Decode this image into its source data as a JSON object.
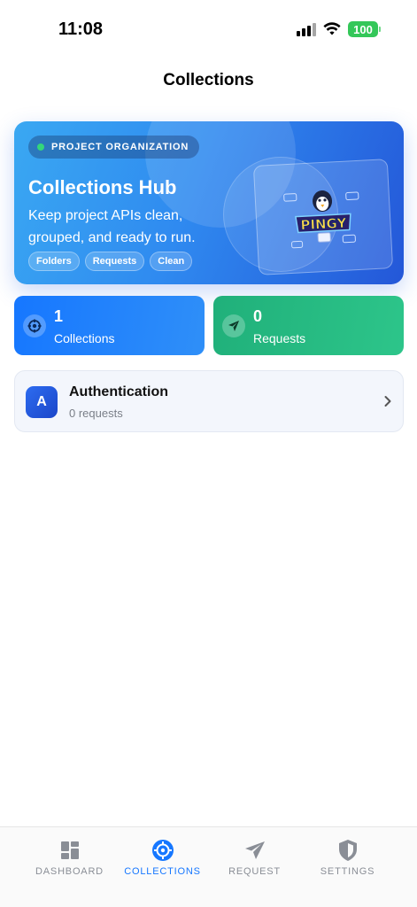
{
  "status_bar": {
    "time": "11:08",
    "battery": "100"
  },
  "header": {
    "title": "Collections"
  },
  "hero": {
    "badge": "PROJECT ORGANIZATION",
    "title": "Collections Hub",
    "subtitle": "Keep project APIs clean, grouped, and ready to run.",
    "tags": [
      "Folders",
      "Requests",
      "Clean"
    ],
    "art_logo_text": "PINGY"
  },
  "stats": [
    {
      "value": "1",
      "label": "Collections",
      "icon": "collections-icon",
      "color": "#1677ff"
    },
    {
      "value": "0",
      "label": "Requests",
      "icon": "paper-plane-icon",
      "color": "#20b07a"
    }
  ],
  "collections": [
    {
      "initial": "A",
      "name": "Authentication",
      "count": "0 requests"
    }
  ],
  "tabbar": {
    "items": [
      {
        "label": "DASHBOARD",
        "icon": "dashboard-icon",
        "active": false
      },
      {
        "label": "COLLECTIONS",
        "icon": "collections-icon",
        "active": true
      },
      {
        "label": "REQUEST",
        "icon": "paper-plane-icon",
        "active": false
      },
      {
        "label": "SETTINGS",
        "icon": "shield-icon",
        "active": false
      }
    ],
    "active_color": "#1677ff"
  }
}
